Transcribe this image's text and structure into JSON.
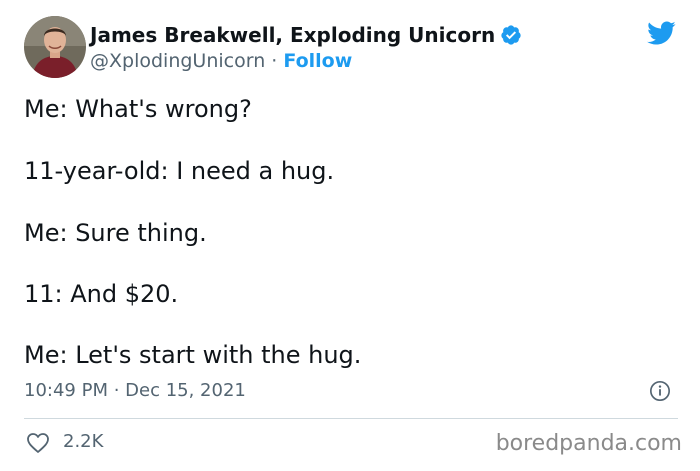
{
  "author": {
    "display_name": "James Breakwell, Exploding Unicorn",
    "handle": "@XplodingUnicorn",
    "separator": " · ",
    "follow_label": "Follow",
    "verified": true
  },
  "tweet": {
    "lines": [
      "Me: What's wrong?",
      "11-year-old: I need a hug.",
      "Me: Sure thing.",
      "11: And $20.",
      "Me: Let's start with the hug."
    ],
    "timestamp": "10:49 PM · Dec 15, 2021"
  },
  "engagement": {
    "likes": "2.2K"
  },
  "watermark": "boredpanda.com",
  "icons": {
    "platform": "twitter-bird-icon",
    "verified": "verified-badge-icon",
    "info": "info-icon",
    "like": "heart-icon"
  },
  "colors": {
    "accent": "#1d9bf0",
    "text": "#0f1419",
    "muted": "#536471",
    "divider": "#cfd9de",
    "watermark": "#8a8a8a"
  }
}
